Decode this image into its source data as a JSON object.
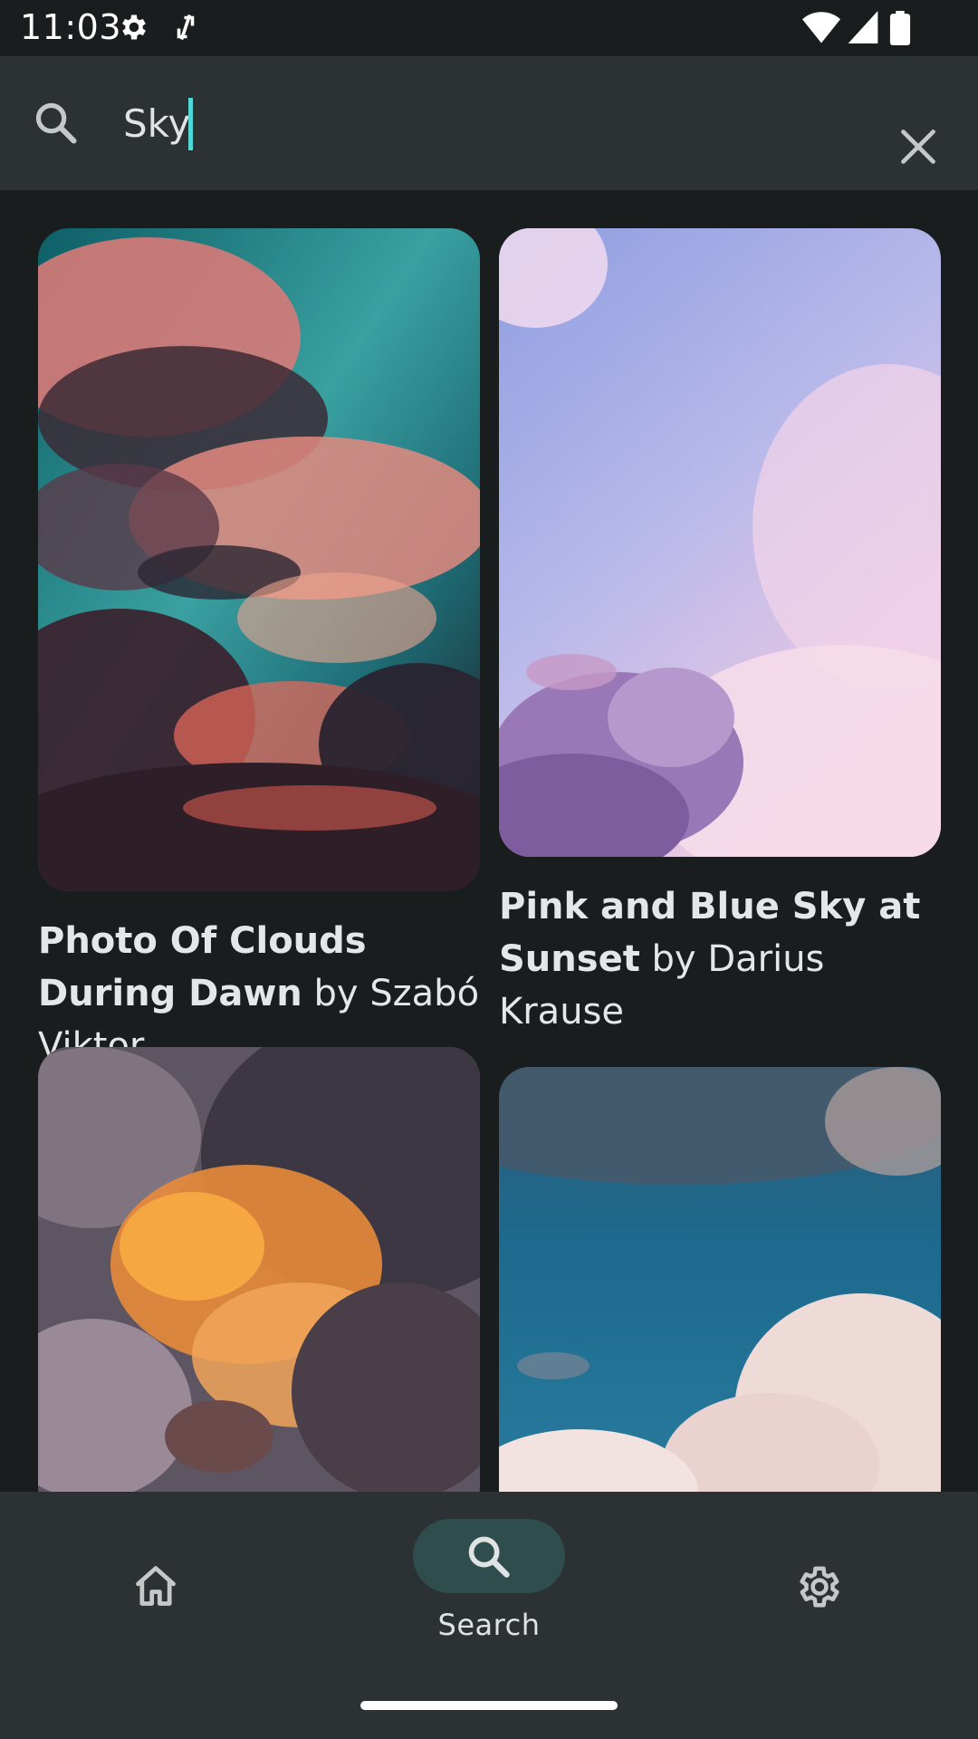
{
  "status_bar": {
    "time": "11:03",
    "left_icons": [
      "gear-icon",
      "data-saver-icon"
    ],
    "right_icons": [
      "wifi-icon",
      "cellular-signal-icon",
      "battery-icon"
    ]
  },
  "search": {
    "value": "Sky",
    "leading_icon": "search-icon",
    "trailing_icon": "close-icon"
  },
  "results": [
    {
      "title": "Photo Of Clouds During Dawn",
      "by_text": " by Szabó Viktor",
      "image": "clouds-dawn"
    },
    {
      "title": "Pink and Blue Sky at Sunset",
      "by_text": " by Darius Krause",
      "image": "pink-blue-sky"
    },
    {
      "title": "",
      "by_text": "",
      "image": "orange-storm-clouds"
    },
    {
      "title": "",
      "by_text": "",
      "image": "blue-sky-white-clouds"
    }
  ],
  "nav": {
    "items": [
      {
        "icon": "home-icon",
        "label": ""
      },
      {
        "icon": "search-icon",
        "label": "Search",
        "selected": true
      },
      {
        "icon": "settings-icon",
        "label": ""
      }
    ]
  },
  "colors": {
    "background": "#191d1e",
    "surface": "#2c3133",
    "accent": "#4fd8d4",
    "nav_pill": "#2f4d4c"
  }
}
